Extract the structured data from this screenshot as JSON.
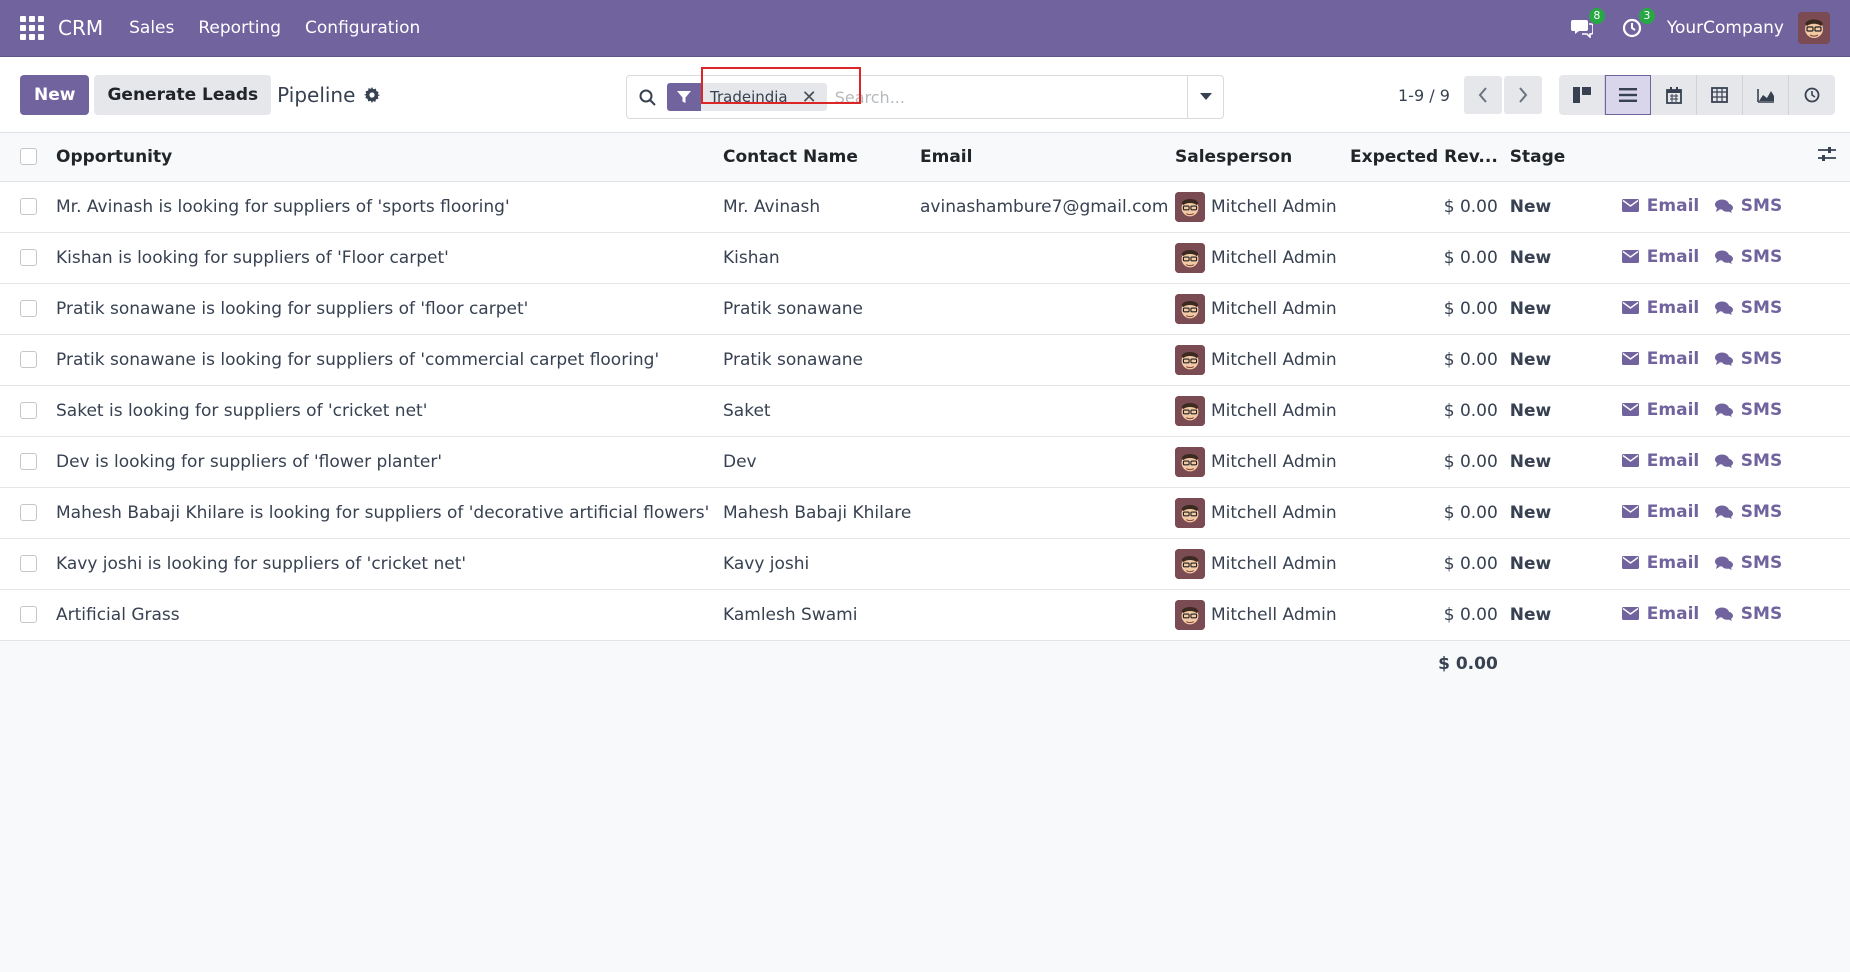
{
  "navbar": {
    "brand": "CRM",
    "menu": [
      "Sales",
      "Reporting",
      "Configuration"
    ],
    "chat_badge": "8",
    "activity_badge": "3",
    "company": "YourCompany"
  },
  "control": {
    "new_label": "New",
    "generate_label": "Generate Leads",
    "title": "Pipeline",
    "facet_value": "Tradeindia",
    "facet_remove": "✕",
    "search_placeholder": "Search...",
    "pager": "1-9 / 9"
  },
  "table": {
    "headers": {
      "opportunity": "Opportunity",
      "contact": "Contact Name",
      "email": "Email",
      "salesperson": "Salesperson",
      "revenue": "Expected Rev...",
      "stage": "Stage"
    },
    "action_email": "Email",
    "action_sms": "SMS",
    "rows": [
      {
        "opportunity": "Mr. Avinash is looking for suppliers of 'sports flooring'",
        "contact": "Mr. Avinash",
        "email": "avinashambure7@gmail.com",
        "salesperson": "Mitchell Admin",
        "revenue": "$ 0.00",
        "stage": "New"
      },
      {
        "opportunity": "Kishan is looking for suppliers of 'Floor carpet'",
        "contact": "Kishan",
        "email": "",
        "salesperson": "Mitchell Admin",
        "revenue": "$ 0.00",
        "stage": "New"
      },
      {
        "opportunity": "Pratik sonawane is looking for suppliers of 'floor carpet'",
        "contact": "Pratik sonawane",
        "email": "",
        "salesperson": "Mitchell Admin",
        "revenue": "$ 0.00",
        "stage": "New"
      },
      {
        "opportunity": "Pratik sonawane is looking for suppliers of 'commercial carpet flooring'",
        "contact": "Pratik sonawane",
        "email": "",
        "salesperson": "Mitchell Admin",
        "revenue": "$ 0.00",
        "stage": "New"
      },
      {
        "opportunity": "Saket is looking for suppliers of 'cricket net'",
        "contact": "Saket",
        "email": "",
        "salesperson": "Mitchell Admin",
        "revenue": "$ 0.00",
        "stage": "New"
      },
      {
        "opportunity": "Dev is looking for suppliers of 'flower planter'",
        "contact": "Dev",
        "email": "",
        "salesperson": "Mitchell Admin",
        "revenue": "$ 0.00",
        "stage": "New"
      },
      {
        "opportunity": "Mahesh Babaji Khilare is looking for suppliers of 'decorative artificial flowers'",
        "contact": "Mahesh Babaji Khilare",
        "email": "",
        "salesperson": "Mitchell Admin",
        "revenue": "$ 0.00",
        "stage": "New"
      },
      {
        "opportunity": "Kavy joshi is looking for suppliers of 'cricket net'",
        "contact": "Kavy joshi",
        "email": "",
        "salesperson": "Mitchell Admin",
        "revenue": "$ 0.00",
        "stage": "New"
      },
      {
        "opportunity": "Artificial Grass",
        "contact": "Kamlesh Swami",
        "email": "",
        "salesperson": "Mitchell Admin",
        "revenue": "$ 0.00",
        "stage": "New"
      }
    ],
    "total_revenue": "$ 0.00"
  },
  "colors": {
    "brand": "#71639e",
    "badge": "#28a745",
    "highlight": "#dc2626"
  }
}
